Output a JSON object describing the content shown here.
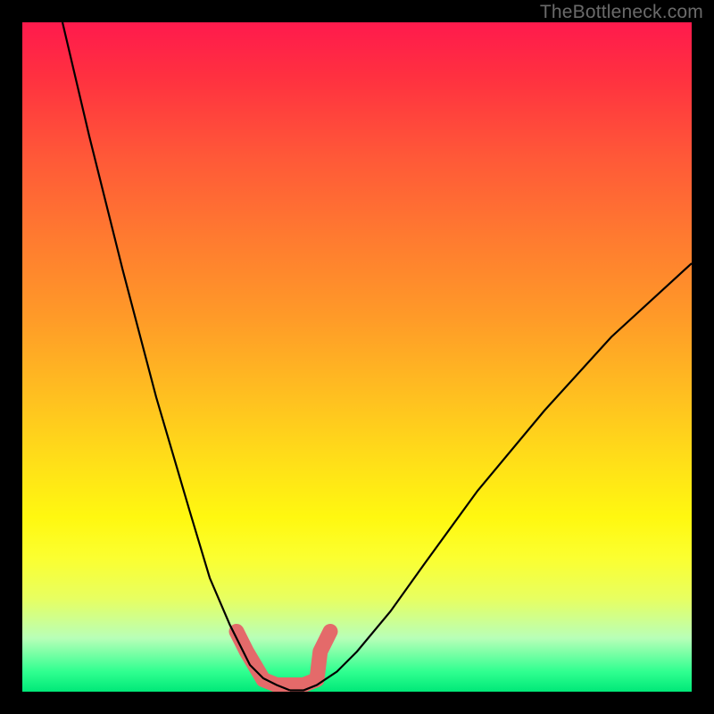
{
  "watermark": "TheBottleneck.com",
  "chart_data": {
    "type": "line",
    "title": "",
    "xlabel": "",
    "ylabel": "",
    "axes_visible": false,
    "grid": false,
    "legend": false,
    "xlim": [
      0,
      100
    ],
    "ylim": [
      0,
      100
    ],
    "background_gradient_top": "#ff1a4d",
    "background_gradient_bottom": "#00e878",
    "series": [
      {
        "name": "left-curve",
        "x": [
          6,
          10,
          15,
          20,
          25,
          28,
          31,
          34,
          36,
          38
        ],
        "y": [
          100,
          83,
          63,
          44,
          27,
          17,
          10,
          4,
          2,
          1
        ]
      },
      {
        "name": "right-curve",
        "x": [
          44,
          47,
          50,
          55,
          60,
          68,
          78,
          88,
          100
        ],
        "y": [
          1,
          3,
          6,
          12,
          19,
          30,
          42,
          53,
          64
        ]
      },
      {
        "name": "notch-floor",
        "x": [
          36,
          38,
          40,
          42,
          44
        ],
        "y": [
          1,
          0.2,
          0.2,
          0.2,
          1
        ]
      }
    ],
    "highlight": {
      "description": "salmon band along the valley floor",
      "color": "#e46a6a",
      "x_range": [
        32,
        46
      ],
      "y_range": [
        0,
        9
      ]
    }
  }
}
